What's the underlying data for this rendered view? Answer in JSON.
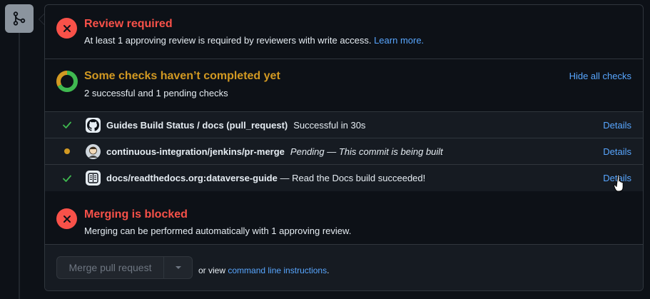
{
  "review": {
    "title": "Review required",
    "subtitle": "At least 1 approving review is required by reviewers with write access.",
    "learn_more": "Learn more."
  },
  "checks": {
    "title": "Some checks haven’t completed yet",
    "subtitle": "2 successful and 1 pending checks",
    "hide_label": "Hide all checks",
    "progress": {
      "successful": 2,
      "pending": 1
    },
    "items": [
      {
        "status": "success",
        "name": "Guides Build Status / docs (pull_request)",
        "description": "Successful in 30s",
        "details": "Details",
        "icon": "github-icon"
      },
      {
        "status": "pending",
        "name": "continuous-integration/jenkins/pr-merge",
        "description": "Pending — This commit is being built",
        "details": "Details",
        "icon": "jenkins-avatar"
      },
      {
        "status": "success",
        "name": "docs/readthedocs.org:dataverse-guide",
        "description": "— Read the Docs build succeeded!",
        "details": "Details",
        "icon": "readthedocs-icon"
      }
    ]
  },
  "merge": {
    "title": "Merging is blocked",
    "subtitle": "Merging can be performed automatically with 1 approving review."
  },
  "action": {
    "button_label": "Merge pull request",
    "alt_prefix": "or view",
    "alt_link": "command line instructions",
    "alt_suffix": "."
  },
  "colors": {
    "danger": "#f85149",
    "attention": "#d29922",
    "success": "#3fb950",
    "accent": "#58a6ff"
  }
}
